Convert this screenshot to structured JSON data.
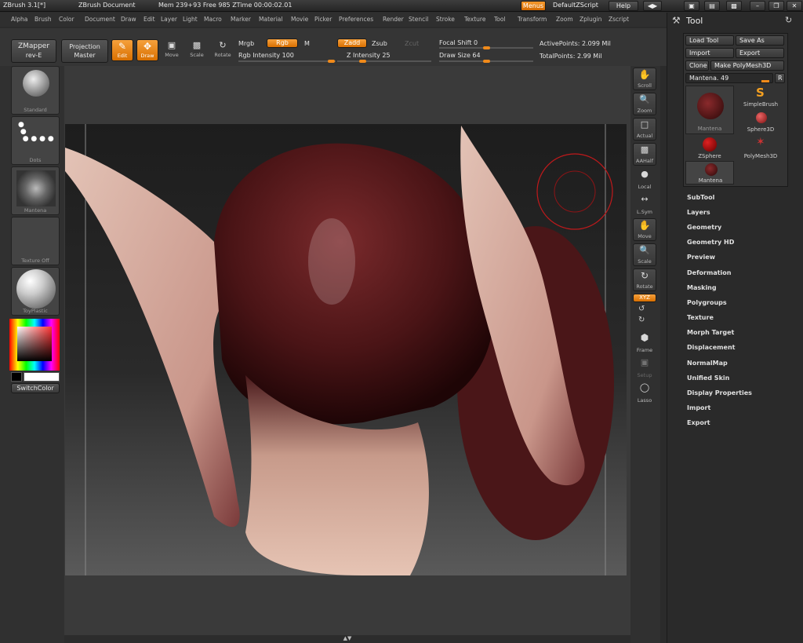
{
  "title": {
    "app": "ZBrush 3.1[*]",
    "document": "ZBrush Document",
    "mem": "Mem 239+93 Free 985 ZTime 00:00:02.01",
    "menus_btn": "Menus",
    "script_btn": "DefaultZScript",
    "help_btn": "Help"
  },
  "menubar": [
    "Alpha",
    "Brush",
    "Color",
    "Document",
    "Draw",
    "Edit",
    "Layer",
    "Light",
    "Macro",
    "Marker",
    "Material",
    "Movie",
    "Picker",
    "Preferences",
    "Render",
    "Stencil",
    "Stroke",
    "Texture",
    "Tool",
    "Transform",
    "Zoom",
    "Zplugin",
    "Zscript"
  ],
  "shelf": {
    "zmapper": "ZMapper",
    "zmapper_sub": "rev-E",
    "projection": "Projection",
    "projection_sub": "Master",
    "edit": "Edit",
    "draw": "Draw",
    "move": "Move",
    "scale": "Scale",
    "rotate": "Rotate",
    "mrgb": "Mrgb",
    "rgb": "Rgb",
    "m": "M",
    "rgb_intensity": "Rgb Intensity 100",
    "zadd": "Zadd",
    "zsub": "Zsub",
    "zcut": "Zcut",
    "z_intensity": "Z Intensity 25",
    "focal_shift": "Focal Shift 0",
    "draw_size": "Draw Size 64",
    "active_points": "ActivePoints: 2.099 Mil",
    "total_points": "TotalPoints: 2.99 Mil"
  },
  "left_shelf": {
    "brushes": [
      "Standard",
      "Dots",
      "Mantena",
      "Texture Off",
      "ToyPlastic"
    ],
    "switch_color": "SwitchColor"
  },
  "right_shelf": [
    "Scroll",
    "Zoom",
    "Actual",
    "AAHalf",
    "Local",
    "L.Sym",
    "Move",
    "Scale",
    "Rotate",
    "XYZ",
    "Frame",
    "Setup",
    "Lasso"
  ],
  "tool_panel": {
    "title": "Tool",
    "load_tool": "Load Tool",
    "save_as": "Save As",
    "import": "Import",
    "export": "Export",
    "clone": "Clone",
    "make_polymesh": "Make PolyMesh3D",
    "mantena_slider": "Mantena. 49",
    "r_btn": "R",
    "thumbs": [
      "Mantena",
      "SimpleBrush",
      "Sphere3D",
      "ZSphere",
      "PolyMesh3D",
      "Mantena"
    ],
    "sections": [
      "SubTool",
      "Layers",
      "Geometry",
      "Geometry HD",
      "Preview",
      "Deformation",
      "Masking",
      "Polygroups",
      "Texture",
      "Morph Target",
      "Displacement",
      "NormalMap",
      "Unified Skin",
      "Display Properties",
      "Import",
      "Export"
    ]
  },
  "colors": {
    "accent": "#f08a1a",
    "model_skin": "#5a1a1c",
    "horn": "#d9b4a6"
  }
}
